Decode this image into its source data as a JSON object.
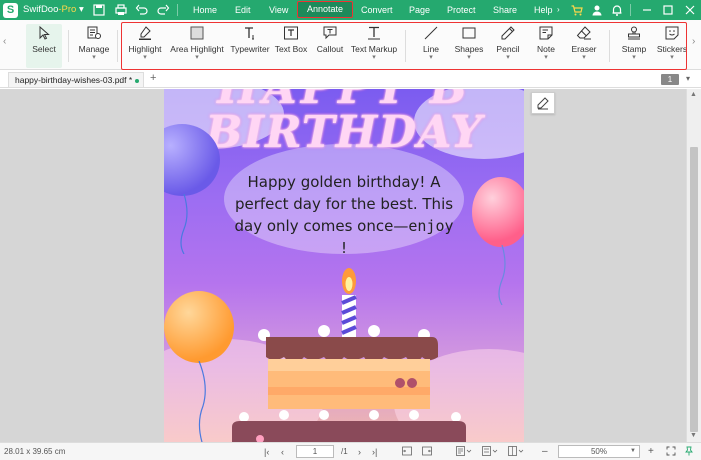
{
  "app": {
    "name": "SwifDoo",
    "edition": "-Pro",
    "edition_caret": "▾"
  },
  "menu": [
    "Home",
    "Edit",
    "View",
    "Annotate",
    "Convert",
    "Page",
    "Protect",
    "Share",
    "Help"
  ],
  "active_menu": "Annotate",
  "ribbon": {
    "select": "Select",
    "manage": "Manage",
    "tools": [
      "Highlight",
      "Area Highlight",
      "Typewriter",
      "Text Box",
      "Callout",
      "Text Markup",
      "Line",
      "Shapes",
      "Pencil",
      "Note",
      "Eraser",
      "Stamp",
      "Stickers"
    ],
    "dropdown_mark": "▾"
  },
  "tabs": {
    "doc_name": "happy-birthday-wishes-03.pdf *",
    "add": "+",
    "page_badge": "1"
  },
  "page_content": {
    "title_top": "HAPPY B",
    "title_main": "BIRTHDAY",
    "wish_line1": "Happy golden birthday! A",
    "wish_line2": "perfect day for the best. This",
    "wish_line3a": "day only comes once—",
    "wish_line3b": "enjoy",
    "wish_line4": "!"
  },
  "status": {
    "dimensions": "28.01 x 39.65 cm",
    "current_page": "1",
    "total_pages": "/1",
    "zoom": "50%",
    "zoom_out": "–",
    "zoom_in": "+"
  },
  "colors": {
    "brand": "#25a96f",
    "highlight_box": "#ee3333"
  }
}
